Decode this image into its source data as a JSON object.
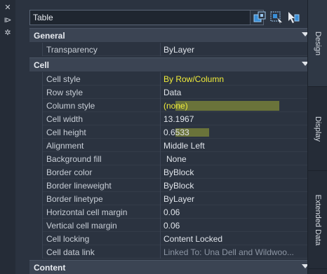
{
  "selector": {
    "value": "Table"
  },
  "sections": {
    "general": "General",
    "cell": "Cell",
    "content": "Content"
  },
  "general_rows": [
    {
      "name": "Transparency",
      "value": "ByLayer"
    }
  ],
  "cell_rows": [
    {
      "name": "Cell style",
      "value": "By Row/Column"
    },
    {
      "name": "Row style",
      "value": "Data"
    },
    {
      "name": "Column style",
      "value": "(none)"
    },
    {
      "name": "Cell width",
      "value": "13.1967"
    },
    {
      "name": "Cell height",
      "value": "0.6533"
    },
    {
      "name": "Alignment",
      "value": "Middle Left"
    },
    {
      "name": "Background fill",
      "value": "None"
    },
    {
      "name": "Border color",
      "value": "ByBlock"
    },
    {
      "name": "Border lineweight",
      "value": "ByBlock"
    },
    {
      "name": "Border linetype",
      "value": "ByLayer"
    },
    {
      "name": "Horizontal cell margin",
      "value": "0.06"
    },
    {
      "name": "Vertical cell margin",
      "value": "0.06"
    },
    {
      "name": "Cell locking",
      "value": "Content Locked"
    },
    {
      "name": "Cell data link",
      "value": "Linked To: Una Dell and Wildwoo..."
    }
  ],
  "tabs": [
    "Design",
    "Display",
    "Extended Data"
  ],
  "colors": {
    "highlight": "#f0ec3a",
    "panel": "#2b3340"
  }
}
